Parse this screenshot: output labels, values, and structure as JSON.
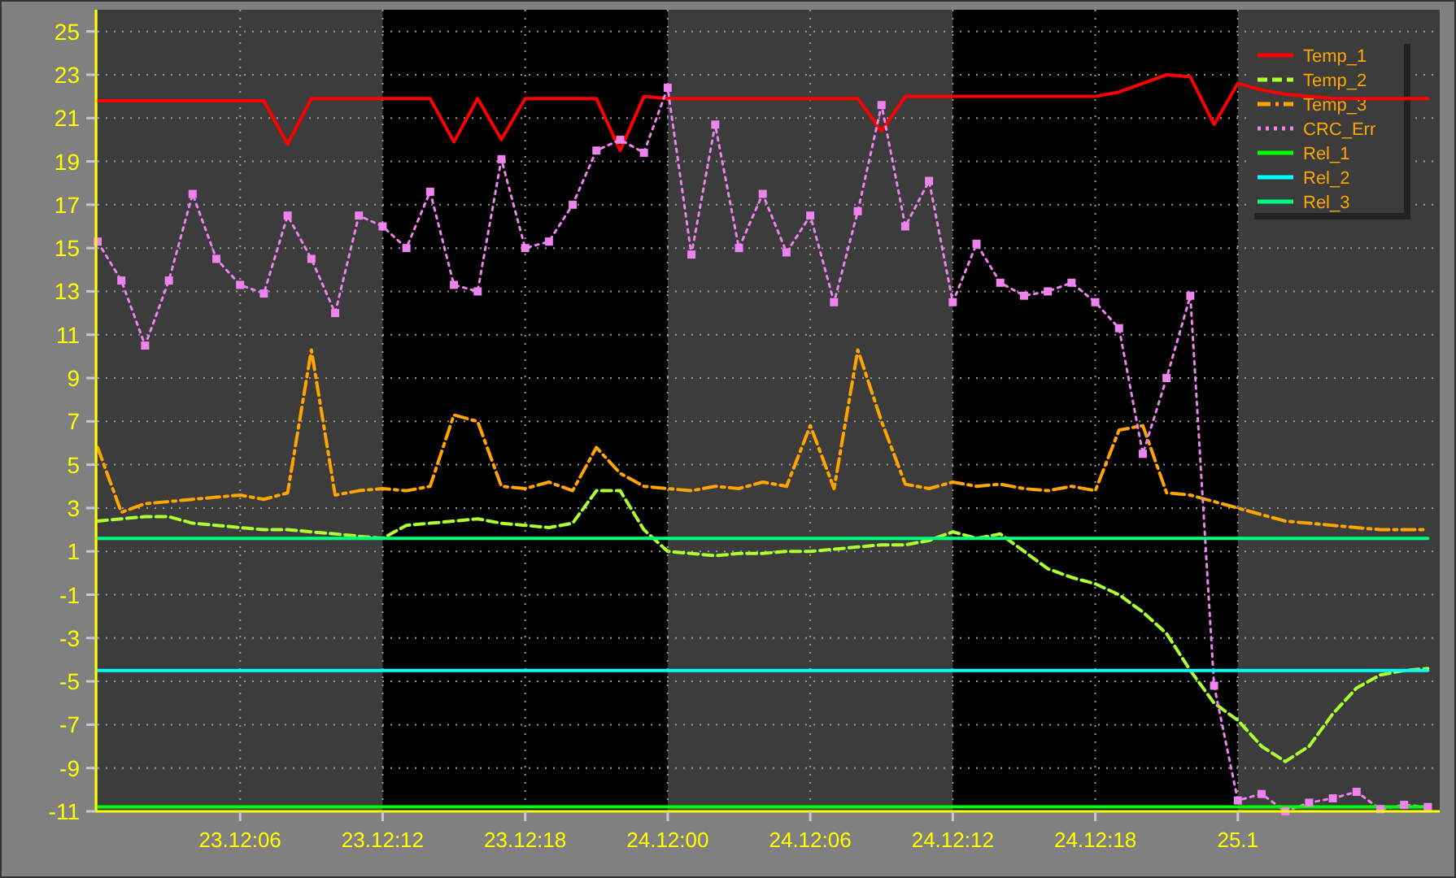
{
  "chart_data": {
    "type": "line",
    "categories": [
      null,
      null,
      null,
      null,
      null,
      null,
      "23.12:06",
      null,
      null,
      null,
      null,
      null,
      "23.12:12",
      null,
      null,
      null,
      null,
      null,
      "23.12:18",
      null,
      null,
      null,
      null,
      null,
      "24.12:00",
      null,
      null,
      null,
      null,
      null,
      "24.12:06",
      null,
      null,
      null,
      null,
      null,
      "24.12:12",
      null,
      null,
      null,
      null,
      null,
      "24.12:18",
      null,
      null,
      null,
      null,
      null,
      "25.1",
      null,
      null,
      null,
      null,
      null,
      null,
      null,
      null
    ],
    "ylim": [
      -11,
      26
    ],
    "grid": true,
    "legend": true,
    "yticks": [
      25,
      23,
      21,
      19,
      17,
      15,
      13,
      11,
      9,
      7,
      5,
      3,
      1,
      -1,
      -3,
      -5,
      -7,
      -9,
      -11
    ],
    "series": [
      {
        "name": "Temp_1",
        "color": "#ff0000",
        "line_style": "solid",
        "values": [
          21.8,
          21.8,
          21.8,
          21.8,
          21.8,
          21.8,
          21.8,
          21.8,
          19.8,
          21.9,
          21.9,
          21.9,
          21.9,
          21.9,
          21.9,
          19.9,
          21.9,
          20.0,
          21.9,
          21.9,
          21.9,
          21.9,
          19.5,
          22.0,
          21.9,
          21.9,
          21.9,
          21.9,
          21.9,
          21.9,
          21.9,
          21.9,
          21.9,
          20.4,
          22.0,
          22.0,
          22.0,
          22.0,
          22.0,
          22.0,
          22.0,
          22.0,
          22.0,
          22.2,
          22.6,
          23.0,
          22.9,
          20.7,
          22.6,
          22.3,
          22.1,
          22.0,
          21.9,
          21.9,
          21.9,
          21.9,
          21.9
        ]
      },
      {
        "name": "Temp_2",
        "color": "#adff2f",
        "line_style": "dashed",
        "values": [
          2.4,
          2.5,
          2.6,
          2.6,
          2.3,
          2.2,
          2.1,
          2.0,
          2.0,
          1.9,
          1.8,
          1.7,
          1.6,
          2.2,
          2.3,
          2.4,
          2.5,
          2.3,
          2.2,
          2.1,
          2.3,
          3.8,
          3.8,
          2.0,
          1.0,
          0.9,
          0.8,
          0.9,
          0.9,
          1.0,
          1.0,
          1.1,
          1.2,
          1.3,
          1.3,
          1.5,
          1.9,
          1.6,
          1.8,
          1.0,
          0.2,
          -0.2,
          -0.5,
          -1.0,
          -1.8,
          -2.8,
          -4.5,
          -6.0,
          -6.8,
          -8.0,
          -8.7,
          -8.0,
          -6.5,
          -5.3,
          -4.7,
          -4.5,
          -4.4
        ]
      },
      {
        "name": "Temp_3",
        "color": "#ffa500",
        "line_style": "dashdot",
        "values": [
          5.8,
          2.8,
          3.2,
          3.3,
          3.4,
          3.5,
          3.6,
          3.4,
          3.7,
          10.3,
          3.6,
          3.8,
          3.9,
          3.8,
          4.0,
          7.3,
          7.0,
          4.0,
          3.9,
          4.2,
          3.8,
          5.8,
          4.6,
          4.0,
          3.9,
          3.8,
          4.0,
          3.9,
          4.2,
          4.0,
          6.8,
          3.9,
          10.3,
          7.0,
          4.1,
          3.9,
          4.2,
          4.0,
          4.1,
          3.9,
          3.8,
          4.0,
          3.8,
          6.6,
          6.8,
          3.7,
          3.6,
          3.3,
          3.0,
          2.7,
          2.4,
          2.3,
          2.2,
          2.1,
          2.0,
          2.0,
          2.0
        ]
      },
      {
        "name": "CRC_Err",
        "color": "#ee82ee",
        "line_style": "dotted",
        "marker": "square",
        "values": [
          15.3,
          13.5,
          10.5,
          13.5,
          17.5,
          14.5,
          13.3,
          12.9,
          16.5,
          14.5,
          12,
          16.5,
          16,
          15,
          17.6,
          13.3,
          13,
          19.1,
          15,
          15.3,
          17,
          19.5,
          20,
          19.4,
          22.4,
          14.7,
          20.7,
          15,
          17.5,
          14.8,
          16.5,
          12.5,
          16.7,
          21.6,
          16,
          18.1,
          12.5,
          15.2,
          13.4,
          12.8,
          13,
          13.4,
          12.5,
          11.3,
          5.5,
          9,
          12.8,
          -5.2,
          -10.5,
          -10.2,
          -11,
          -10.6,
          -10.4,
          -10.1,
          -10.9,
          -10.7,
          -10.8
        ]
      },
      {
        "name": "Rel_1",
        "color": "#00ff00",
        "line_style": "solid",
        "values": [
          -10.8,
          -10.8,
          -10.8,
          -10.8,
          -10.8,
          -10.8,
          -10.8,
          -10.8,
          -10.8,
          -10.8,
          -10.8,
          -10.8,
          -10.8,
          -10.8,
          -10.8,
          -10.8,
          -10.8,
          -10.8,
          -10.8,
          -10.8,
          -10.8,
          -10.8,
          -10.8,
          -10.8,
          -10.8,
          -10.8,
          -10.8,
          -10.8,
          -10.8,
          -10.8,
          -10.8,
          -10.8,
          -10.8,
          -10.8,
          -10.8,
          -10.8,
          -10.8,
          -10.8,
          -10.8,
          -10.8,
          -10.8,
          -10.8,
          -10.8,
          -10.8,
          -10.8,
          -10.8,
          -10.8,
          -10.8,
          -10.8,
          -10.8,
          -10.8,
          -10.8,
          -10.8,
          -10.8,
          -10.8,
          -10.8,
          -10.8
        ]
      },
      {
        "name": "Rel_2",
        "color": "#00ffff",
        "line_style": "solid",
        "values": [
          -4.5,
          -4.5,
          -4.5,
          -4.5,
          -4.5,
          -4.5,
          -4.5,
          -4.5,
          -4.5,
          -4.5,
          -4.5,
          -4.5,
          -4.5,
          -4.5,
          -4.5,
          -4.5,
          -4.5,
          -4.5,
          -4.5,
          -4.5,
          -4.5,
          -4.5,
          -4.5,
          -4.5,
          -4.5,
          -4.5,
          -4.5,
          -4.5,
          -4.5,
          -4.5,
          -4.5,
          -4.5,
          -4.5,
          -4.5,
          -4.5,
          -4.5,
          -4.5,
          -4.5,
          -4.5,
          -4.5,
          -4.5,
          -4.5,
          -4.5,
          -4.5,
          -4.5,
          -4.5,
          -4.5,
          -4.5,
          -4.5,
          -4.5,
          -4.5,
          -4.5,
          -4.5,
          -4.5,
          -4.5,
          -4.5,
          -4.5
        ]
      },
      {
        "name": "Rel_3",
        "color": "#00ff7f",
        "line_style": "solid",
        "values": [
          1.6,
          1.6,
          1.6,
          1.6,
          1.6,
          1.6,
          1.6,
          1.6,
          1.6,
          1.6,
          1.6,
          1.6,
          1.6,
          1.6,
          1.6,
          1.6,
          1.6,
          1.6,
          1.6,
          1.6,
          1.6,
          1.6,
          1.6,
          1.6,
          1.6,
          1.6,
          1.6,
          1.6,
          1.6,
          1.6,
          1.6,
          1.6,
          1.6,
          1.6,
          1.6,
          1.6,
          1.6,
          1.6,
          1.6,
          1.6,
          1.6,
          1.6,
          1.6,
          1.6,
          1.6,
          1.6,
          1.6,
          1.6,
          1.6,
          1.6,
          1.6,
          1.6,
          1.6,
          1.6,
          1.6,
          1.6,
          1.6
        ]
      }
    ]
  }
}
